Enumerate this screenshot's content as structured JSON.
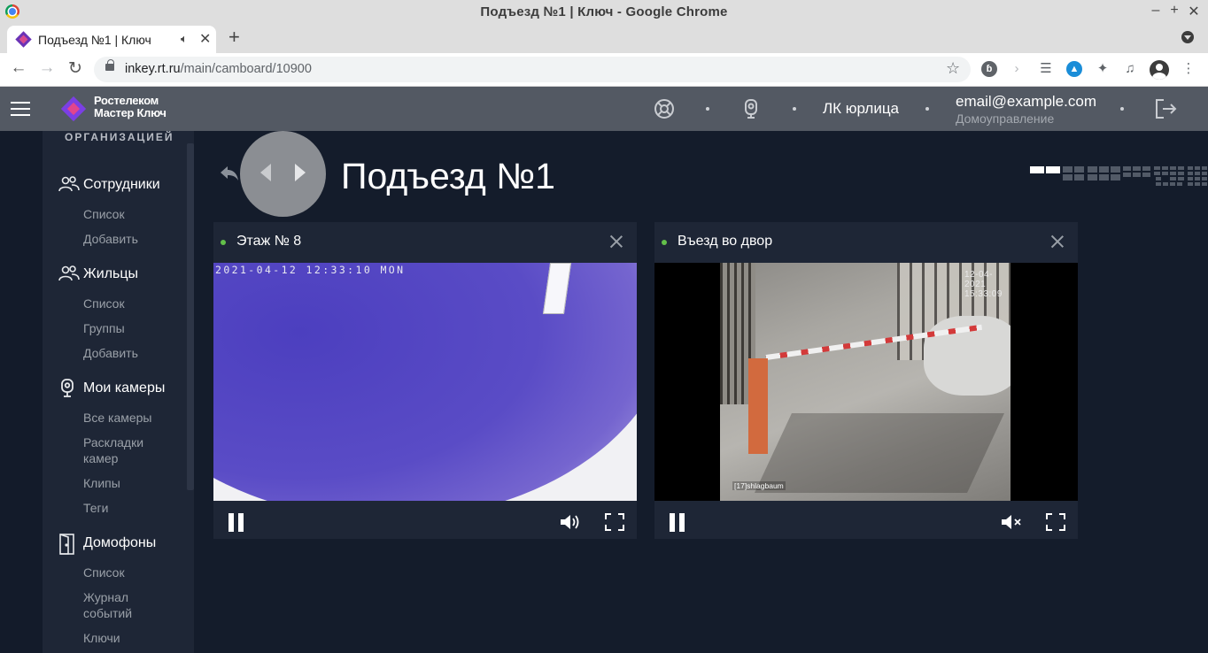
{
  "browser": {
    "window_title": "Подъезд №1 | Ключ - Google Chrome",
    "tab_title": "Подъезд №1 | Ключ",
    "url_domain": "inkey.rt.ru",
    "url_path": "/main/camboard/10900"
  },
  "header": {
    "logo_line1": "Ростелеком",
    "logo_line2": "Мастер Ключ",
    "org_link": "ЛК юрлица",
    "email": "email@example.com",
    "org_name": "Домоуправление"
  },
  "sidebar": {
    "heading": "ОРГАНИЗАЦИЕЙ",
    "sections": [
      {
        "label": "Сотрудники",
        "items": [
          "Список",
          "Добавить"
        ]
      },
      {
        "label": "Жильцы",
        "items": [
          "Список",
          "Группы",
          "Добавить"
        ]
      },
      {
        "label": "Мои камеры",
        "items": [
          "Все камеры",
          "Раскладки камер",
          "Клипы",
          "Теги"
        ]
      },
      {
        "label": "Домофоны",
        "items": [
          "Список",
          "Журнал событий",
          "Ключи"
        ]
      }
    ]
  },
  "main": {
    "title": "Подъезд №1",
    "cameras": [
      {
        "title": "Этаж № 8",
        "osd": "2021-04-12 12:33:10 MON",
        "status_color": "#63c04a",
        "muted": false
      },
      {
        "title": "Въезд во двор",
        "osd": "12-04-2021 15:33:09",
        "label": "[17]shlagbaum",
        "status_color": "#63c04a",
        "muted": true
      }
    ]
  },
  "colors": {
    "header_bg": "#535963",
    "sidebar_bg": "#1e2636",
    "page_bg": "#141c2b",
    "status_online": "#63c04a"
  }
}
